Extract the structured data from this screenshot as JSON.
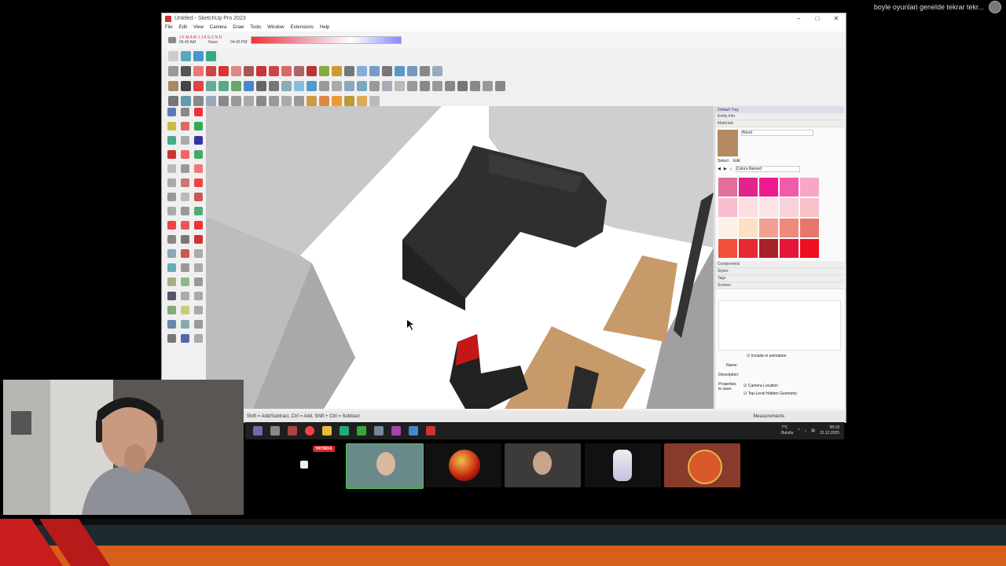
{
  "ticker": {
    "text": "boyle oyunlari genelde tekrar tekr..."
  },
  "window": {
    "title": "Untitled - SketchUp Pro 2023",
    "controls": [
      "–",
      "□",
      "✕"
    ]
  },
  "menu": [
    "File",
    "Edit",
    "View",
    "Camera",
    "Draw",
    "Tools",
    "Window",
    "Extensions",
    "Help"
  ],
  "shadow_bar": {
    "months": "J F M A M J J A S O N D",
    "time_left": "06:43 AM",
    "noon": "Noon",
    "time_right": "04:45 PM"
  },
  "status_bar": {
    "hint": "Shift = Add/Subtract, Ctrl = Add, Shift + Ctrl = Subtract",
    "measurements_label": "Measurements"
  },
  "tray": {
    "title": "Default Tray",
    "sections": {
      "entity_info": "Entity Info",
      "materials": "Materials",
      "components": "Components",
      "styles": "Styles",
      "tags": "Tags",
      "scenes": "Scenes"
    },
    "material_name": "Wood",
    "select_tab": "Select",
    "edit_tab": "Edit",
    "library": "Colors-Named",
    "swatches": [
      "#e0709a",
      "#e0248a",
      "#f01a90",
      "#f45aaa",
      "#f7a6c8",
      "#f7bfcd",
      "#fcdde0",
      "#fbe5e4",
      "#f7d2d8",
      "#f7c3c8",
      "#fdf0e6",
      "#fde0c6",
      "#f2a090",
      "#ef8a7c",
      "#e8766c",
      "#f0503c",
      "#e62a32",
      "#a8222a",
      "#e4163a",
      "#ee1020"
    ],
    "scene_fields": {
      "include_animation": "Include in animation",
      "name": "Name:",
      "description": "Description:",
      "properties": "Properties to save:",
      "camera_location": "Camera Location",
      "hidden_geometry": "Top-Level Hidden Geometry"
    }
  },
  "taskbar": {
    "weather_temp": "7°C",
    "weather_desc": "Bulutlu",
    "clock_time": "08:18",
    "clock_date": "31.12.2025"
  },
  "live_badge": "YAYINDA"
}
